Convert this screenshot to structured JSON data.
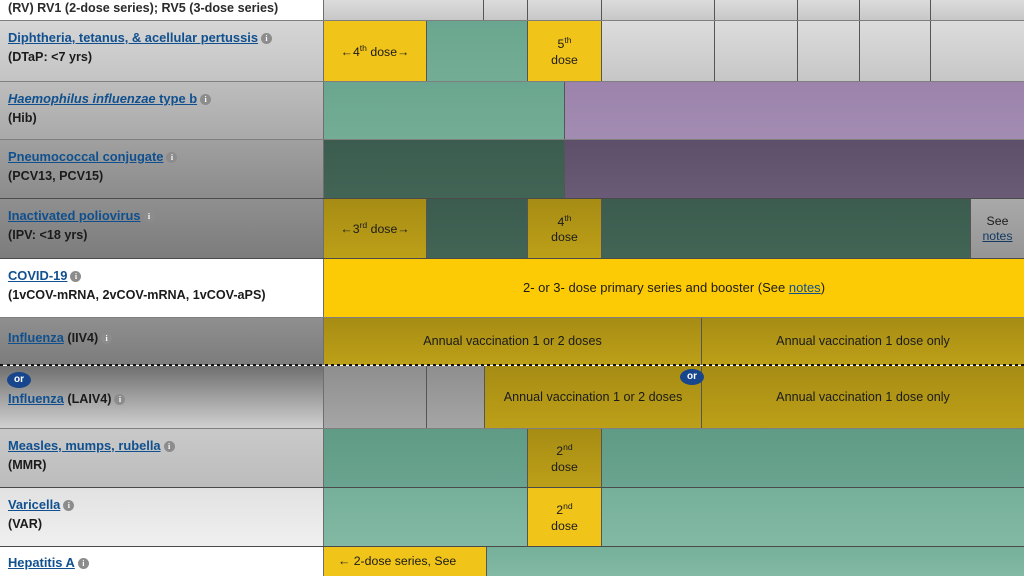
{
  "table": {
    "rows": [
      {
        "id": "rotavirus",
        "label_top": "(RV) RV1 (2-dose series); RV5 (3-dose series)",
        "label_paren": ""
      },
      {
        "id": "dtap",
        "vaccine": "Diphtheria, tetanus, & acellular pertussis",
        "label_paren": "(DTaP: <7 yrs)",
        "cells": [
          {
            "text": "←4th dose→",
            "sup": "th",
            "kind": "yellow"
          },
          {
            "text": "",
            "kind": "green"
          },
          {
            "text": "5th dose",
            "kind": "yellow"
          }
        ]
      },
      {
        "id": "hib",
        "vaccine": "Haemophilus influenzae type b",
        "label_paren": "(Hib)",
        "cells": [
          {
            "text": "",
            "kind": "green"
          },
          {
            "text": "",
            "kind": "purple"
          }
        ]
      },
      {
        "id": "pcv",
        "vaccine": "Pneumococcal conjugate",
        "label_paren": "(PCV13, PCV15)",
        "cells": [
          {
            "text": "",
            "kind": "green-dark"
          },
          {
            "text": "",
            "kind": "purple-dark"
          }
        ]
      },
      {
        "id": "ipv",
        "vaccine": "Inactivated poliovirus",
        "label_paren": "(IPV: <18 yrs)",
        "cells": [
          {
            "text": "←3rd dose→",
            "kind": "yellow-dark"
          },
          {
            "text": "",
            "kind": "green-dark"
          },
          {
            "text": "4th dose",
            "kind": "yellow-dark"
          },
          {
            "text": "",
            "kind": "green-dark"
          },
          {
            "text": "See notes",
            "kind": "grey-dark"
          }
        ]
      },
      {
        "id": "covid19",
        "vaccine": "COVID-19",
        "label_paren": "(1vCOV-mRNA, 2vCOV-mRNA, 1vCOV-aPS)",
        "cells": [
          {
            "text": "2- or 3- dose primary series and booster (See notes)",
            "kind": "yellow-bright"
          }
        ]
      },
      {
        "id": "influenza-iiv4",
        "vaccine": "Influenza",
        "label_suffix": "(IIV4)",
        "cells": [
          {
            "text": "Annual vaccination 1 or 2 doses",
            "kind": "yellow-dark"
          },
          {
            "text": "Annual vaccination 1 dose only",
            "kind": "yellow-dark"
          }
        ]
      },
      {
        "id": "influenza-laiv4",
        "vaccine": "Influenza",
        "label_suffix": "(LAIV4)",
        "or_badge": "or",
        "cells": [
          {
            "text": "",
            "kind": "grey-dark2"
          },
          {
            "text": "Annual vaccination 1 or 2 doses",
            "kind": "yellow-dark"
          },
          {
            "text": "Annual vaccination 1 dose only",
            "kind": "yellow-dark"
          }
        ]
      },
      {
        "id": "mmr",
        "vaccine": "Measles, mumps, rubella",
        "label_paren": "(MMR)",
        "cells": [
          {
            "text": "",
            "kind": "green-mid"
          },
          {
            "text": "2nd dose",
            "kind": "yellow-dark"
          },
          {
            "text": "",
            "kind": "green-mid"
          }
        ]
      },
      {
        "id": "varicella",
        "vaccine": "Varicella",
        "label_paren": "(VAR)",
        "cells": [
          {
            "text": "",
            "kind": "green-light"
          },
          {
            "text": "2nd dose",
            "kind": "yellow"
          },
          {
            "text": "",
            "kind": "green-light"
          }
        ]
      },
      {
        "id": "hepa",
        "vaccine": "Hepatitis A",
        "label_paren": "",
        "cells": [
          {
            "text": "← 2-dose series, See",
            "kind": "yellow"
          },
          {
            "text": "",
            "kind": "green-light"
          }
        ]
      }
    ],
    "text": {
      "rotavirus_top": "(RV) RV1 (2-dose series); RV5 (3-dose series)",
      "dtap_name": "Diphtheria, tetanus, & acellular pertussis",
      "dtap_paren": "(DTaP: <7 yrs)",
      "dtap_dose4_pre": "←",
      "dtap_dose4_num": "4",
      "dtap_dose4_sup": "th",
      "dtap_dose4_post": " dose→",
      "dtap_dose5_num": "5",
      "dtap_dose5_sup": "th",
      "dtap_dose5_word": "dose",
      "hib_name": "Haemophilus influenzae",
      "hib_name_tail": " type b",
      "hib_paren": "(Hib)",
      "pcv_name": "Pneumococcal conjugate",
      "pcv_paren": "(PCV13, PCV15)",
      "ipv_name": "Inactivated poliovirus",
      "ipv_paren": "(IPV: <18 yrs)",
      "ipv_dose3_pre": "←",
      "ipv_dose3_num": "3",
      "ipv_dose3_sup": "rd",
      "ipv_dose3_post": " dose→",
      "ipv_dose4_num": "4",
      "ipv_dose4_sup": "th",
      "ipv_dose4_word": "dose",
      "ipv_see": "See",
      "ipv_notes": "notes",
      "covid_name": "COVID-19",
      "covid_paren": "(1vCOV-mRNA, 2vCOV-mRNA, 1vCOV-aPS)",
      "covid_cell_pre": "2- or 3- dose primary series and booster (See ",
      "covid_cell_link": "notes",
      "covid_cell_post": ")",
      "flu_name": "Influenza",
      "flu_iiv4": "(IIV4)",
      "flu_laiv4": "(LAIV4)",
      "flu_or": "or",
      "flu_annual_1or2": "Annual vaccination 1 or 2 doses",
      "flu_annual_1only": "Annual vaccination 1 dose only",
      "flu_laiv_1or2": "Annual vaccination 1 or 2 doses",
      "flu_laiv_1only": "Annual vaccination 1 dose only",
      "mmr_name": "Measles, mumps, rubella",
      "mmr_paren": "(MMR)",
      "mmr_dose_num": "2",
      "mmr_dose_sup": "nd",
      "mmr_dose_word": "dose",
      "var_name": "Varicella",
      "var_paren": "(VAR)",
      "var_dose_num": "2",
      "var_dose_sup": "nd",
      "var_dose_word": "dose",
      "hepa_name": "Hepatitis A",
      "hepa_cell": "← 2-dose series, See",
      "info_glyph": "i"
    },
    "colors": {
      "link": "#10508f",
      "yellow": "#f0c419",
      "yellow_bright": "#fdcb05",
      "green": "#6aa68f",
      "purple": "#9b83ab",
      "or_badge": "#18468c"
    }
  }
}
